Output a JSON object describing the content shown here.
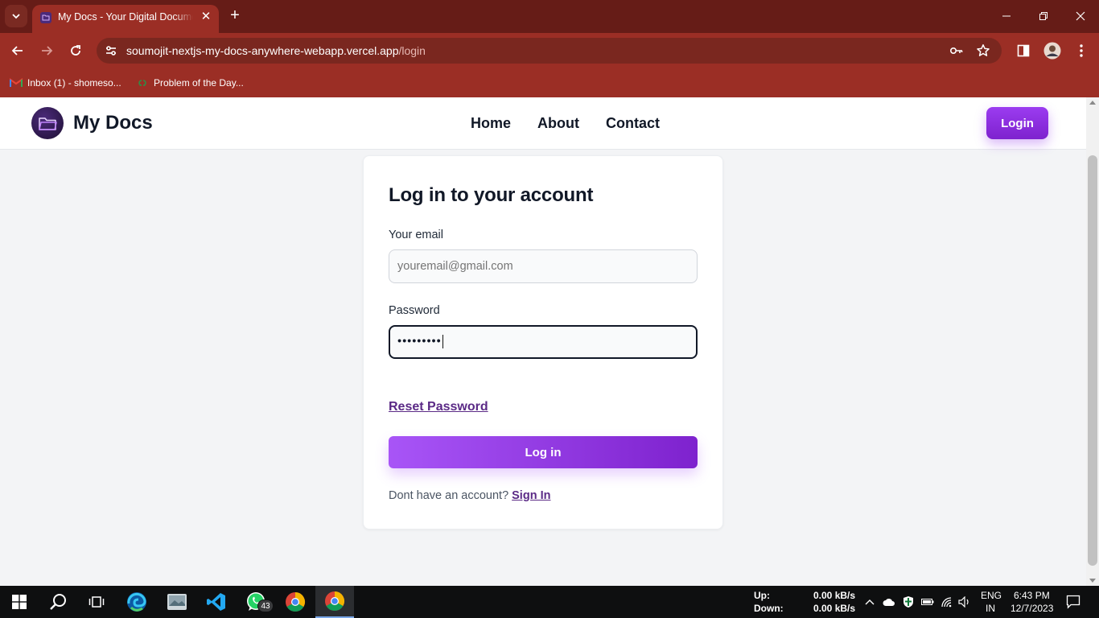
{
  "browser": {
    "tab_title": "My Docs - Your Digital Document Manager",
    "url_host": "soumojit-nextjs-my-docs-anywhere-webapp.vercel.app",
    "url_path": "/login",
    "bookmarks": [
      {
        "label": "Inbox (1) - shomeso..."
      },
      {
        "label": "Problem of the Day..."
      }
    ],
    "theme": {
      "tabbar": "#661c17",
      "toolbar": "#9b2e25"
    }
  },
  "site": {
    "brand": "My Docs",
    "nav": [
      "Home",
      "About",
      "Contact"
    ],
    "login_button": "Login",
    "accent": "#9333ea"
  },
  "form": {
    "title": "Log in to your account",
    "email_label": "Your email",
    "email_placeholder": "youremail@gmail.com",
    "password_label": "Password",
    "password_value": "•••••••••",
    "reset_link": "Reset Password",
    "submit": "Log in",
    "signup_prompt": "Dont have an account?",
    "signup_link": "Sign In"
  },
  "taskbar": {
    "whatsapp_badge": "43",
    "net_up_label": "Up:",
    "net_down_label": "Down:",
    "net_up_value": "0.00 kB/s",
    "net_down_value": "0.00 kB/s",
    "lang": "ENG",
    "region": "IN",
    "time": "6:43 PM",
    "date": "12/7/2023"
  }
}
